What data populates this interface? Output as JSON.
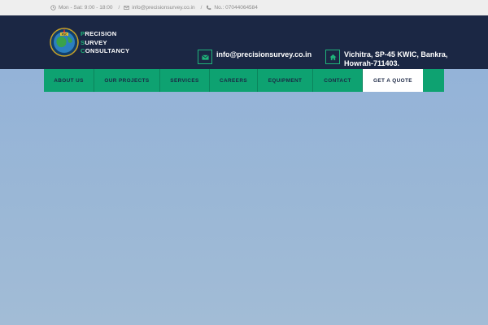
{
  "topbar": {
    "hours": "Mon - Sat: 9:00 - 18:00",
    "email": "info@precisionsurvey.co.in",
    "phone": "No.: 07044064584",
    "separator": "/",
    "icons": [
      "clock-icon",
      "envelope-icon",
      "phone-icon"
    ]
  },
  "brand": {
    "line1_cap": "P",
    "line1_rest": "RECISION",
    "line2_cap": "S",
    "line2_rest": "URVEY",
    "line3_cap": "C",
    "line3_rest": "ONSULTANCY"
  },
  "contact": {
    "email": "info@precisionsurvey.co.in",
    "address_line1": "Vichitra, SP-45 KWIC, Bankra,",
    "address_line2": "Howrah-711403."
  },
  "nav": {
    "items": [
      "ABOUT US",
      "OUR PROJECTS",
      "SERVICES",
      "CAREERS",
      "EQUIPMENT",
      "CONTACT"
    ],
    "quote": "GET A QUOTE"
  },
  "colors": {
    "header_bg": "#1b2744",
    "accent_green": "#1fb37a",
    "nav_bg": "#0ea271",
    "hero_bg": "#9ab6d6"
  }
}
